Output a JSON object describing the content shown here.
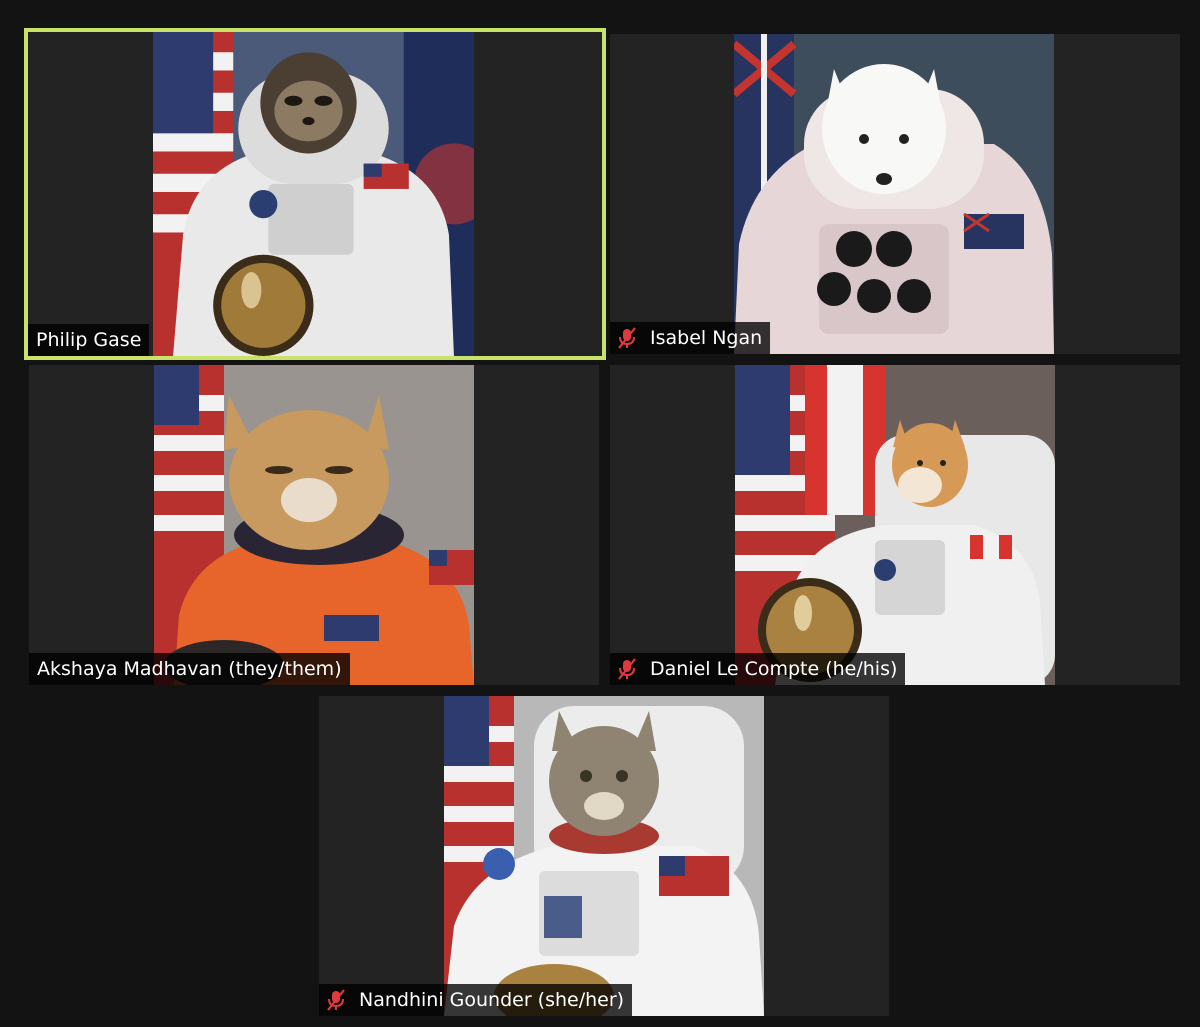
{
  "participants": [
    {
      "name": "Philip Gase",
      "muted": false,
      "active_speaker": true,
      "avatar": "sloth-astronaut"
    },
    {
      "name": "Isabel Ngan",
      "muted": true,
      "active_speaker": false,
      "avatar": "white-dog-astronaut"
    },
    {
      "name": "Akshaya Madhavan (they/them)",
      "muted": false,
      "active_speaker": false,
      "avatar": "orange-cat-astronaut"
    },
    {
      "name": "Daniel Le Compte (he/his)",
      "muted": true,
      "active_speaker": false,
      "avatar": "shiba-astronaut"
    },
    {
      "name": "Nandhini Gounder (she/her)",
      "muted": true,
      "active_speaker": false,
      "avatar": "tabby-cat-astronaut"
    }
  ],
  "colors": {
    "background": "#131313",
    "tile": "#232323",
    "active_border": "#c9e26a",
    "mute_icon": "#e0393e",
    "name_text": "#ffffff"
  },
  "icons": {
    "muted": "microphone-muted-icon"
  }
}
